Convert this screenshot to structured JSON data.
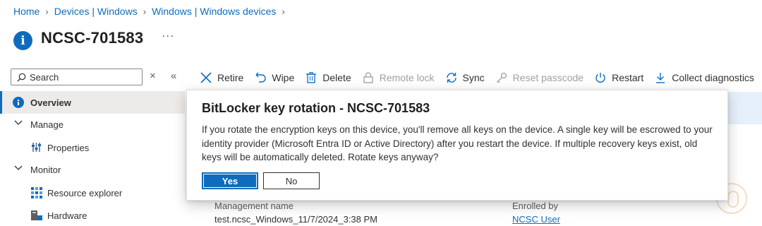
{
  "breadcrumb": [
    "Home",
    "Devices | Windows",
    "Windows | Windows devices"
  ],
  "page": {
    "title": "NCSC-701583",
    "more": "···"
  },
  "search": {
    "placeholder": "Search",
    "close": "×",
    "collapse": "«"
  },
  "sidebar": {
    "items": [
      {
        "label": "Overview",
        "icon": "info-icon",
        "active": true
      },
      {
        "label": "Manage",
        "icon": "chevron-down-icon"
      },
      {
        "label": "Properties",
        "icon": "properties-icon"
      },
      {
        "label": "Monitor",
        "icon": "chevron-down-icon"
      },
      {
        "label": "Resource explorer",
        "icon": "resource-explorer-icon"
      },
      {
        "label": "Hardware",
        "icon": "hardware-icon"
      }
    ]
  },
  "toolbar": {
    "retire": "Retire",
    "wipe": "Wipe",
    "delete": "Delete",
    "remote_lock": "Remote lock",
    "sync": "Sync",
    "reset_passcode": "Reset passcode",
    "restart": "Restart",
    "collect_diagnostics": "Collect diagnostics",
    "more": "···"
  },
  "details": {
    "management_name_label": "Management name",
    "management_name_value": "test.ncsc_Windows_11/7/2024_3:38 PM",
    "enrolled_by_label": "Enrolled by",
    "enrolled_by_value": "NCSC User"
  },
  "dialog": {
    "title": "BitLocker key rotation - NCSC-701583",
    "body": "If you rotate the encryption keys on this device, you'll remove all keys on the device. A single key will be escrowed to your identity provider (Microsoft Entra ID or Active Directory) after you restart the device. If multiple recovery keys exist, old keys will be automatically deleted. Rotate keys anyway?",
    "yes_label": "Yes",
    "no_label": "No"
  },
  "colors": {
    "accent": "#0f6cbd",
    "disabled": "#a19f9d"
  }
}
